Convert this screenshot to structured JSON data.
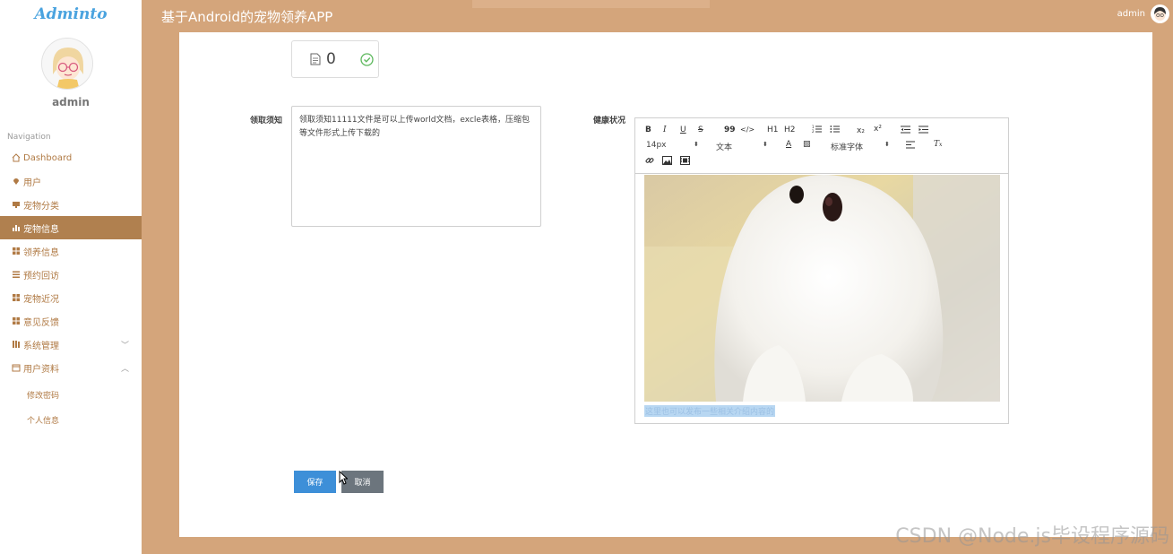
{
  "app": {
    "brand": "Adminto",
    "title": "基于Android的宠物领养APP",
    "user": "admin"
  },
  "sidebar": {
    "username": "admin",
    "nav_title": "Navigation",
    "items": [
      {
        "label": "Dashboard",
        "icon": "home-icon"
      },
      {
        "label": "用户",
        "icon": "pin-icon"
      },
      {
        "label": "宠物分类",
        "icon": "monitor-icon"
      },
      {
        "label": "宠物信息",
        "icon": "bar-chart-icon",
        "active": true
      },
      {
        "label": "领养信息",
        "icon": "grid-icon"
      },
      {
        "label": "预约回访",
        "icon": "list-icon"
      },
      {
        "label": "宠物近况",
        "icon": "grid-icon"
      },
      {
        "label": "意见反馈",
        "icon": "grid-icon"
      },
      {
        "label": "系统管理",
        "icon": "library-icon",
        "expand": "down"
      },
      {
        "label": "用户资料",
        "icon": "calendar-icon",
        "expand": "up"
      }
    ],
    "sub_items": [
      "修改密码",
      "个人信息"
    ]
  },
  "upload": {
    "file_count": "0"
  },
  "form": {
    "adoption_label": "领取须知",
    "adoption_text": "领取须知11111文件是可以上传world文档，excle表格，压缩包等文件形式上传下载的",
    "health_label": "健康状况",
    "health_caption": "这里也可以发布一些相关介绍内容的"
  },
  "editor": {
    "buttons": [
      "B",
      "I",
      "U",
      "S",
      "99",
      "</>",
      "H1",
      "H2"
    ],
    "font_size": "14px",
    "block_type": "文本",
    "font_family": "标准字体"
  },
  "actions": {
    "save": "保存",
    "cancel": "取消"
  },
  "watermark": "CSDN @Node.js毕设程序源码",
  "colors": {
    "accent": "#b0804f",
    "background": "#d4a57b",
    "primary_button": "#3d8fd8",
    "secondary_button": "#6c757d"
  }
}
